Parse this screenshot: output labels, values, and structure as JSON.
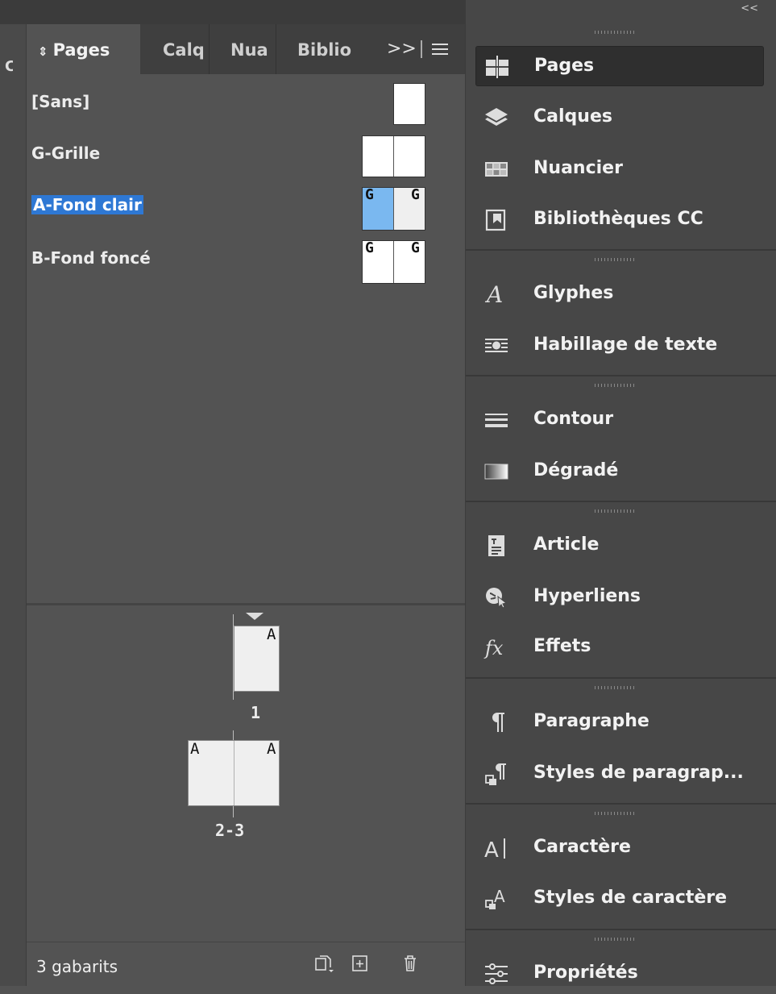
{
  "window": {
    "edge_glyph": "C"
  },
  "pages_panel": {
    "tabs": [
      {
        "label": "Pages",
        "icon": "updown-icon"
      },
      {
        "label": "Calq"
      },
      {
        "label": "Nua"
      },
      {
        "label": "Biblio"
      }
    ],
    "tab_chevron": ">>",
    "masters": [
      {
        "label": "[Sans]",
        "selected": false
      },
      {
        "label": "G-Grille",
        "selected": false
      },
      {
        "label": "A-Fond clair",
        "selected": true,
        "left_letter": "G",
        "right_letter": "G"
      },
      {
        "label": "B-Fond foncé",
        "selected": false,
        "left_letter": "G",
        "right_letter": "G"
      }
    ],
    "pages": [
      {
        "number": "1",
        "letters": [
          "A"
        ]
      },
      {
        "number": "2-3",
        "letters": [
          "A",
          "A"
        ]
      }
    ],
    "status": "3 gabarits",
    "status_icons": [
      "edit-page-size-icon",
      "new-page-icon",
      "trash-icon"
    ]
  },
  "dock": {
    "collapse_label": "<<",
    "items": [
      {
        "label": "Pages",
        "icon": "pages-icon",
        "selected": true
      },
      {
        "label": "Calques",
        "icon": "layers-icon"
      },
      {
        "label": "Nuancier",
        "icon": "swatches-icon"
      },
      {
        "label": "Bibliothèques CC",
        "icon": "cc-libraries-icon"
      },
      {
        "label": "Glyphes",
        "icon": "glyphs-icon"
      },
      {
        "label": "Habillage de texte",
        "icon": "text-wrap-icon"
      },
      {
        "label": "Contour",
        "icon": "stroke-icon"
      },
      {
        "label": "Dégradé",
        "icon": "gradient-icon"
      },
      {
        "label": "Article",
        "icon": "article-icon"
      },
      {
        "label": "Hyperliens",
        "icon": "hyperlinks-icon"
      },
      {
        "label": "Effets",
        "icon": "effects-icon"
      },
      {
        "label": "Paragraphe",
        "icon": "paragraph-icon"
      },
      {
        "label": "Styles de paragrap...",
        "icon": "paragraph-styles-icon"
      },
      {
        "label": "Caractère",
        "icon": "character-icon"
      },
      {
        "label": "Styles de caractère",
        "icon": "character-styles-icon"
      },
      {
        "label": "Propriétés",
        "icon": "properties-icon"
      }
    ]
  },
  "colors": {
    "selection": "#2e78d4",
    "thumb_highlight": "#7ab8f0",
    "panel_bg": "#535353",
    "dock_bg": "#474747"
  }
}
